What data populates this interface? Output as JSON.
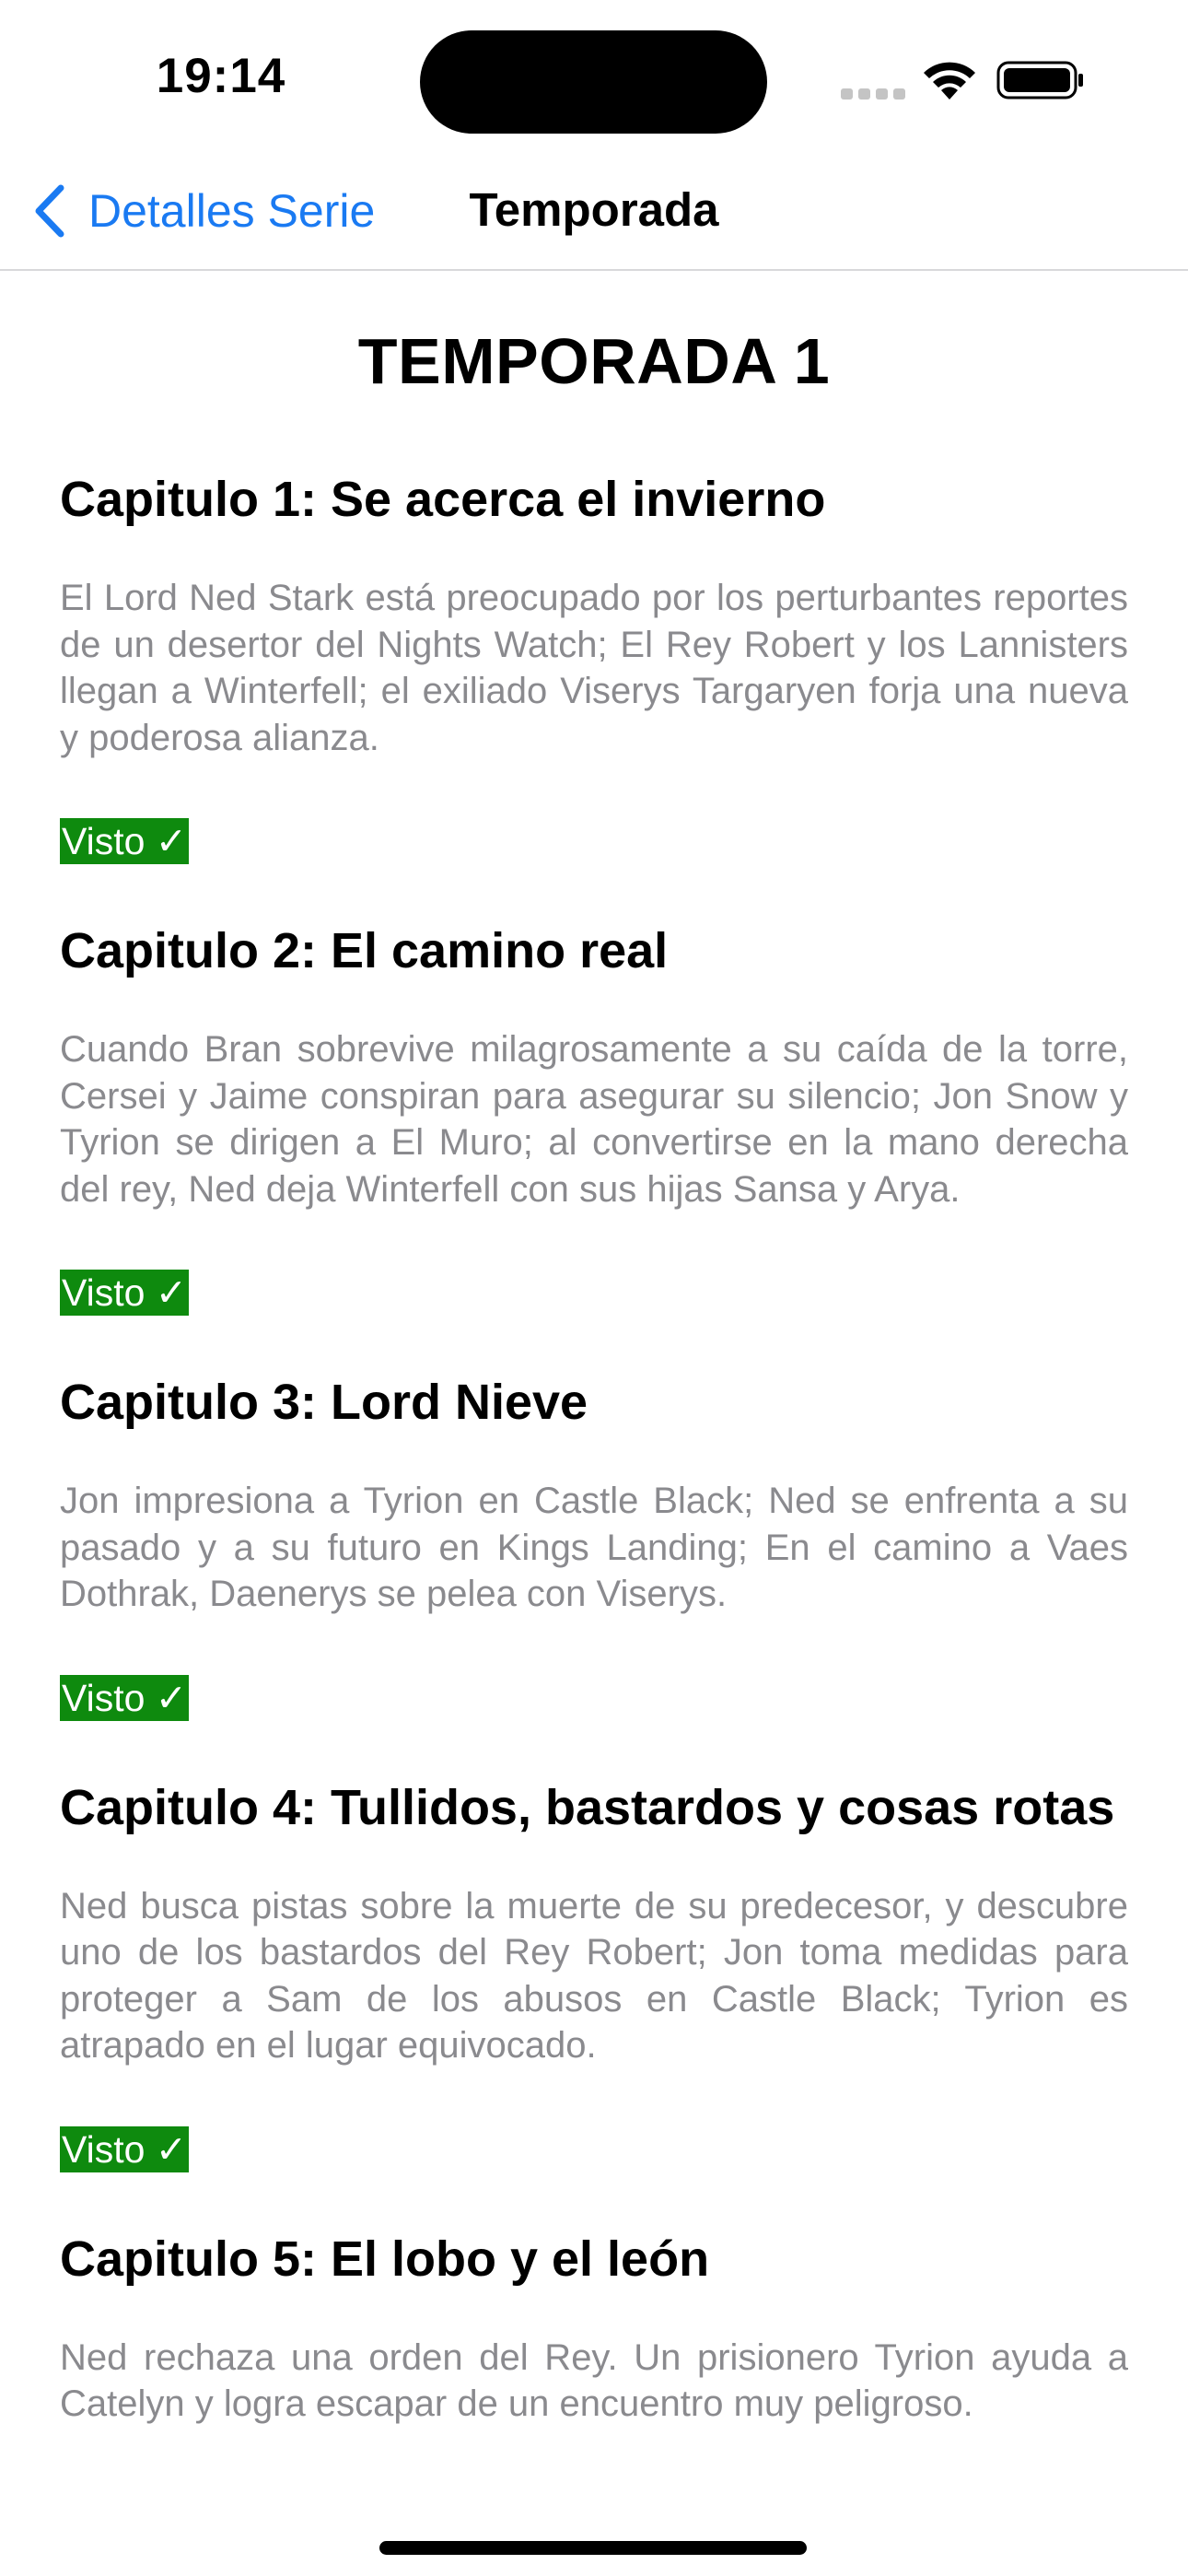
{
  "status_bar": {
    "time": "19:14",
    "icons": [
      "cellular-signal-icon",
      "wifi-icon",
      "battery-icon"
    ]
  },
  "nav": {
    "back_label": "Detalles Serie",
    "back_icon": "chevron-left-icon",
    "title": "Temporada"
  },
  "colors": {
    "accent": "#1a7af2",
    "watched_badge": "#0e8a0e",
    "synopsis_text": "#8a8a8e"
  },
  "season": {
    "title": "TEMPORADA 1"
  },
  "episodes": [
    {
      "title": "Capitulo 1: Se acerca el invierno",
      "synopsis": "El Lord Ned Stark está preocupado por los perturbantes reportes de un desertor del Nights Watch; El Rey Robert y los Lannisters llegan a Winterfell; el exiliado Viserys Targaryen forja una nueva y poderosa alianza.",
      "status": "Visto ✓"
    },
    {
      "title": "Capitulo 2: El camino real",
      "synopsis": "Cuando Bran sobrevive milagrosamente a su caída de la torre, Cersei y Jaime conspiran para asegurar su silencio; Jon Snow y Tyrion se dirigen a El Muro; al convertirse en la mano derecha del rey, Ned deja Winterfell con sus hijas Sansa y Arya.",
      "status": "Visto ✓"
    },
    {
      "title": "Capitulo 3: Lord Nieve",
      "synopsis": "Jon impresiona a Tyrion en Castle Black; Ned se enfrenta a su pasado y a su futuro en Kings Landing; En el camino a Vaes Dothrak, Daenerys se pelea con Viserys.",
      "status": "Visto ✓"
    },
    {
      "title": "Capitulo 4: Tullidos, bastardos y cosas rotas",
      "synopsis": "Ned busca pistas sobre la muerte de su predecesor, y descubre uno de los bastardos del Rey Robert; Jon toma medidas para proteger a Sam de los abusos en Castle Black; Tyrion es atrapado en el lugar equivocado.",
      "status": "Visto ✓"
    },
    {
      "title": "Capitulo 5: El lobo y el león",
      "synopsis": "Ned rechaza una orden del Rey. Un prisionero Tyrion ayuda a Catelyn y logra escapar de un encuentro muy peligroso.",
      "status": ""
    }
  ]
}
